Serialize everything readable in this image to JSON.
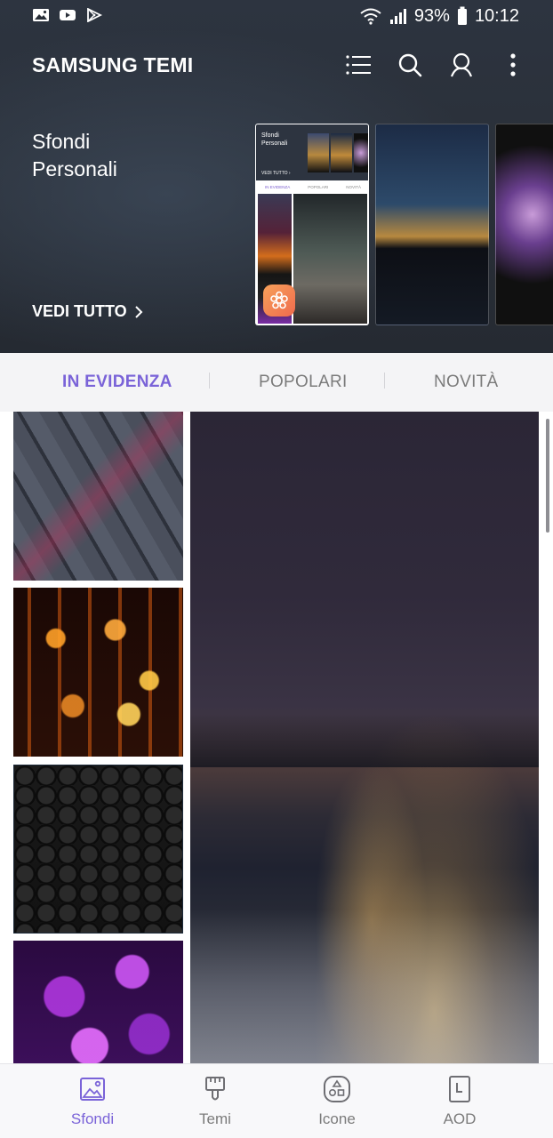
{
  "status_bar": {
    "battery_percent": "93%",
    "time": "10:12",
    "left_icons": [
      "image-notification-icon",
      "youtube-icon",
      "play-store-icon"
    ],
    "right_icons": [
      "wifi-icon",
      "signal-icon",
      "battery-icon"
    ]
  },
  "header": {
    "title": "SAMSUNG TEMI",
    "actions": [
      "list-icon",
      "search-icon",
      "account-icon",
      "more-vert-icon"
    ]
  },
  "featured": {
    "title": "Sfondi\nPersonali",
    "see_all_label": "VEDI TUTTO",
    "mini_preview": {
      "title": "Sfondi\nPersonali",
      "see_all": "VEDI TUTTO ›",
      "tabs": [
        "IN EVIDENZA",
        "POPOLARI",
        "NOVITÀ"
      ]
    }
  },
  "tabs": [
    {
      "label": "IN EVIDENZA",
      "active": true
    },
    {
      "label": "POPOLARI",
      "active": false
    },
    {
      "label": "NOVITÀ",
      "active": false
    }
  ],
  "bottom_nav": [
    {
      "label": "Sfondi",
      "icon": "wallpaper-icon",
      "active": true
    },
    {
      "label": "Temi",
      "icon": "brush-icon",
      "active": false
    },
    {
      "label": "Icone",
      "icon": "shapes-icon",
      "active": false
    },
    {
      "label": "AOD",
      "icon": "clock-display-icon",
      "active": false
    }
  ],
  "colors": {
    "accent": "#7a63d8",
    "header_bg": "#2a3039",
    "inactive_text": "#7b7b7b"
  }
}
